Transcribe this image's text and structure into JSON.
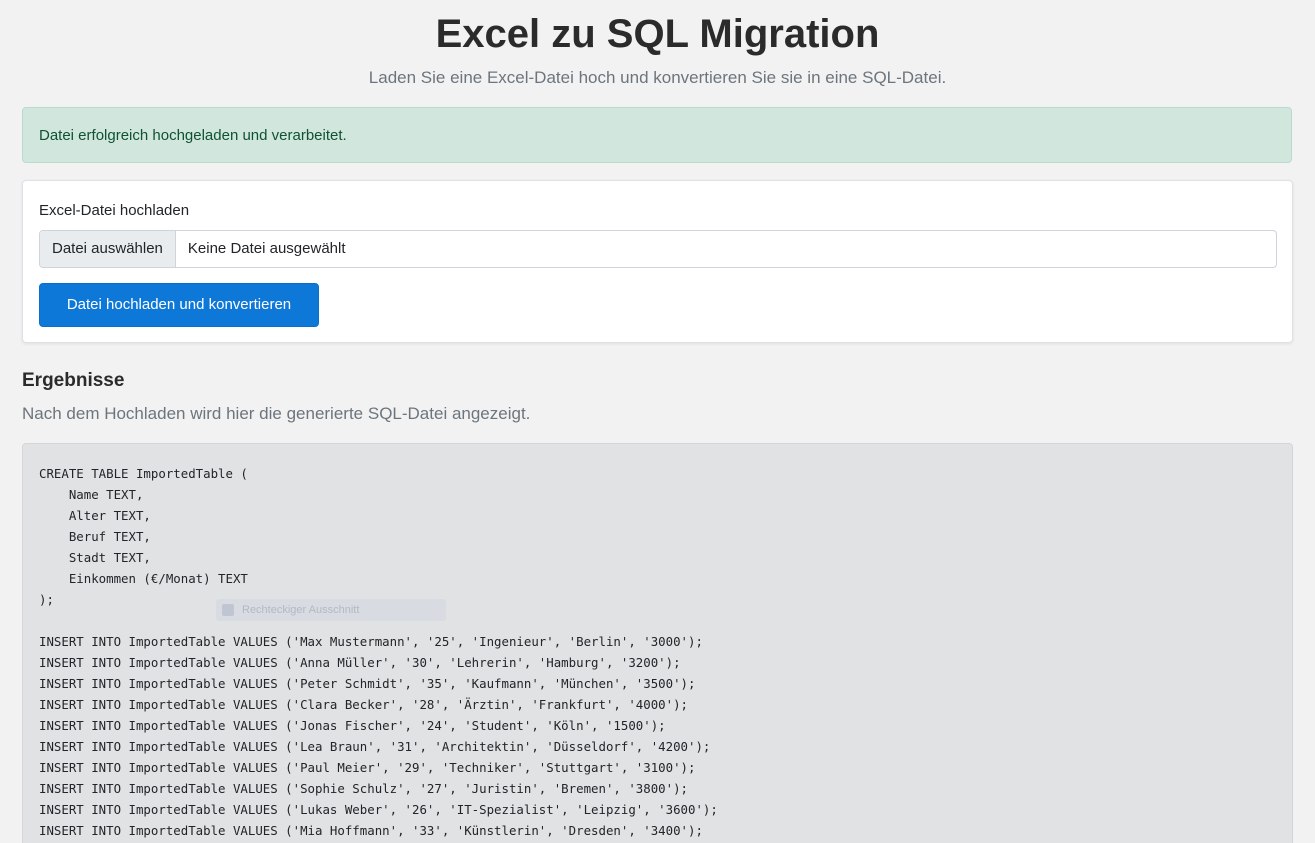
{
  "header": {
    "title": "Excel zu SQL Migration",
    "subtitle": "Laden Sie eine Excel-Datei hoch und konvertieren Sie sie in eine SQL-Datei."
  },
  "alert": {
    "message": "Datei erfolgreich hochgeladen und verarbeitet.",
    "color": "#d1e7dd"
  },
  "upload": {
    "label": "Excel-Datei hochladen",
    "choose_button": "Datei auswählen",
    "file_status": "Keine Datei ausgewählt",
    "submit_label": "Datei hochladen und konvertieren",
    "accent_color": "#0d78d8"
  },
  "results": {
    "heading": "Ergebnisse",
    "description": "Nach dem Hochladen wird hier die generierte SQL-Datei angezeigt.",
    "code_lines": [
      "CREATE TABLE ImportedTable (",
      "    Name TEXT,",
      "    Alter TEXT,",
      "    Beruf TEXT,",
      "    Stadt TEXT,",
      "    Einkommen (€/Monat) TEXT",
      ");",
      "",
      "INSERT INTO ImportedTable VALUES ('Max Mustermann', '25', 'Ingenieur', 'Berlin', '3000');",
      "INSERT INTO ImportedTable VALUES ('Anna Müller', '30', 'Lehrerin', 'Hamburg', '3200');",
      "INSERT INTO ImportedTable VALUES ('Peter Schmidt', '35', 'Kaufmann', 'München', '3500');",
      "INSERT INTO ImportedTable VALUES ('Clara Becker', '28', 'Ärztin', 'Frankfurt', '4000');",
      "INSERT INTO ImportedTable VALUES ('Jonas Fischer', '24', 'Student', 'Köln', '1500');",
      "INSERT INTO ImportedTable VALUES ('Lea Braun', '31', 'Architektin', 'Düsseldorf', '4200');",
      "INSERT INTO ImportedTable VALUES ('Paul Meier', '29', 'Techniker', 'Stuttgart', '3100');",
      "INSERT INTO ImportedTable VALUES ('Sophie Schulz', '27', 'Juristin', 'Bremen', '3800');",
      "INSERT INTO ImportedTable VALUES ('Lukas Weber', '26', 'IT-Spezialist', 'Leipzig', '3600');",
      "INSERT INTO ImportedTable VALUES ('Mia Hoffmann', '33', 'Künstlerin', 'Dresden', '3400');",
      ""
    ]
  },
  "overlay": {
    "ghost_label": "Rechteckiger Ausschnitt"
  }
}
